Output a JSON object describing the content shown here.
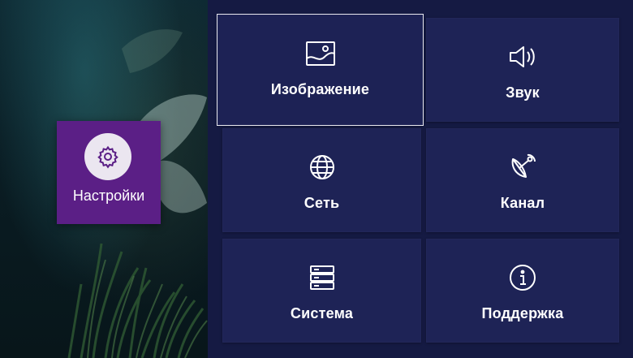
{
  "left_menu": {
    "settings_label": "Настройки",
    "settings_icon": "gear-icon",
    "accent_color": "#5b1f86"
  },
  "tiles": [
    {
      "label": "Изображение",
      "icon": "picture-icon",
      "selected": true
    },
    {
      "label": "Звук",
      "icon": "speaker-icon",
      "selected": false
    },
    {
      "label": "Сеть",
      "icon": "globe-icon",
      "selected": false
    },
    {
      "label": "Канал",
      "icon": "satellite-dish-icon",
      "selected": false
    },
    {
      "label": "Система",
      "icon": "system-icon",
      "selected": false
    },
    {
      "label": "Поддержка",
      "icon": "info-icon",
      "selected": false
    }
  ],
  "colors": {
    "panel_bg": "#151a43",
    "tile_bg": "#1e2356",
    "text": "#ffffff"
  }
}
